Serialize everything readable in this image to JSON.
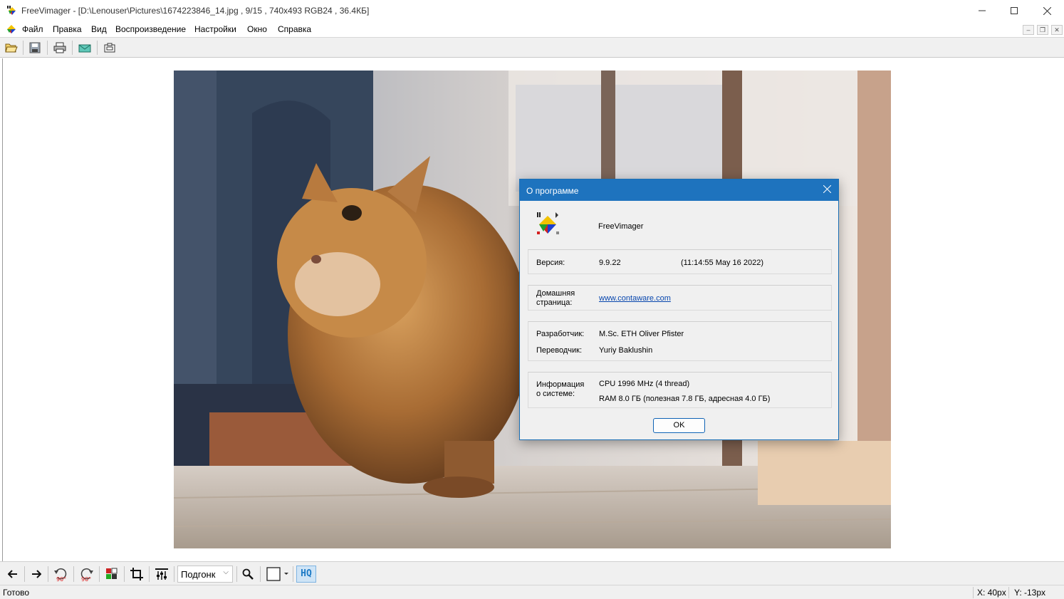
{
  "window": {
    "title": "FreeVimager - [D:\\Lenouser\\Pictures\\1674223846_14.jpg , 9/15 , 740x493 RGB24 , 36.4КБ]",
    "minimize_icon": "minimize-icon",
    "maximize_icon": "maximize-icon",
    "close_icon": "close-icon"
  },
  "menu": {
    "items": [
      "Файл",
      "Правка",
      "Вид",
      "Воспроизведение",
      "Настройки",
      "Окно",
      "Справка"
    ]
  },
  "toolbar_top": {
    "buttons": [
      "open-icon",
      "save-icon",
      "print-icon",
      "email-icon",
      "screenshot-icon"
    ]
  },
  "dialog": {
    "title": "О программе",
    "app_name": "FreeVimager",
    "version_label": "Версия:",
    "version": "9.9.22",
    "build_date": "(11:14:55  May 16 2022)",
    "homepage_label": "Домашняя\nстраница:",
    "homepage_url": "www.contaware.com",
    "developer_label": "Разработчик:",
    "developer": "M.Sc. ETH Oliver Pfister",
    "translator_label": "Переводчик:",
    "translator": "Yuriy Baklushin",
    "sysinfo_label": "Информация\nо системе:",
    "cpu": "CPU  1996 MHz (4 thread)",
    "ram": "RAM  8.0 ГБ (полезная 7.8 ГБ, адресная 4.0 ГБ)",
    "ok_label": "OK"
  },
  "toolbar_bottom": {
    "zoom_value": "Подгонк",
    "rotate_left_label": "90°",
    "rotate_right_label": "90°",
    "hq_label": "HQ"
  },
  "status": {
    "text": "Готово",
    "x": "X: 40px",
    "y": "Y: -13px"
  },
  "colors": {
    "dialog_title_bar": "#1e73be",
    "link": "#0645ad",
    "hq_accent": "#1e7bc6"
  }
}
